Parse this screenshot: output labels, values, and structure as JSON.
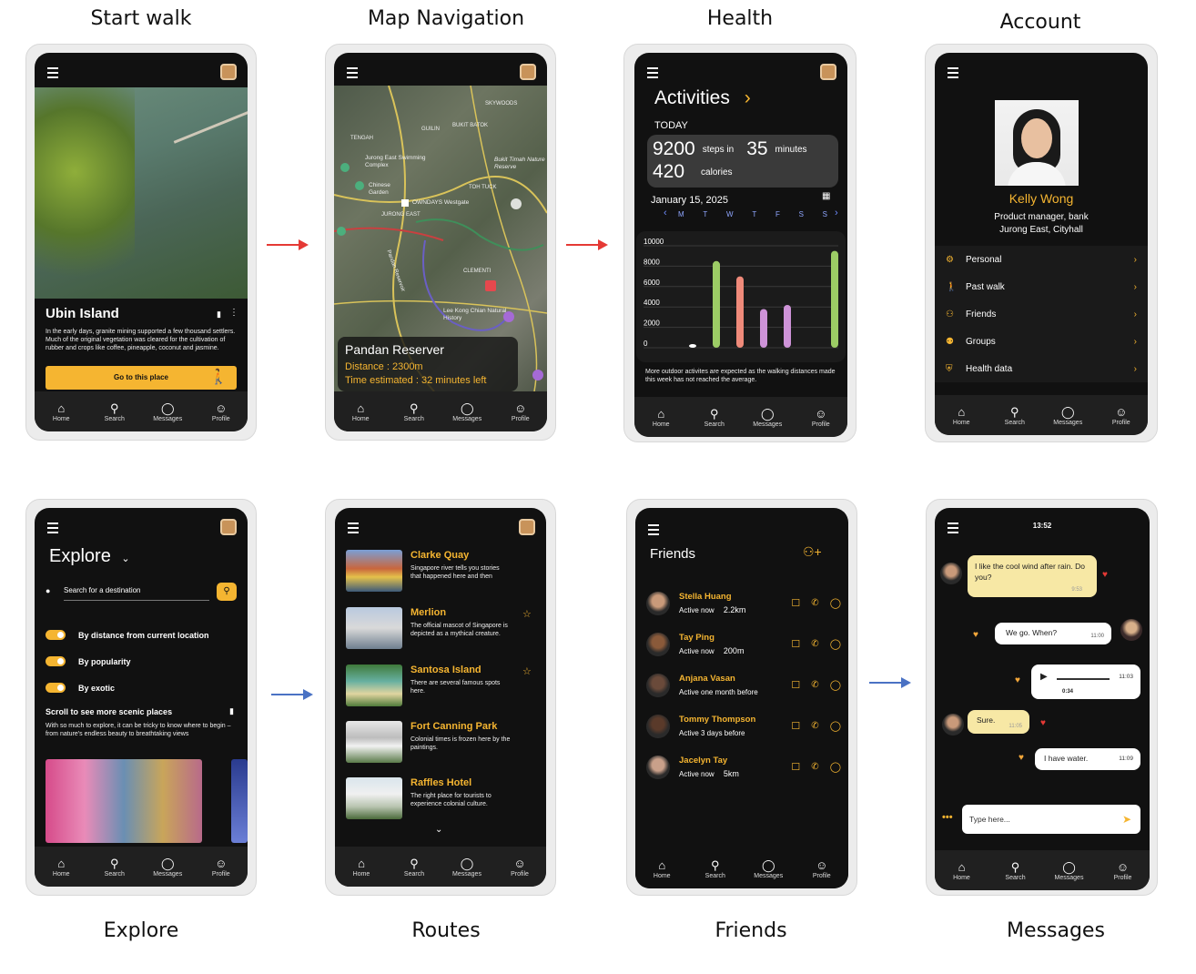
{
  "captions": {
    "start_walk": "Start walk",
    "map_navigation": "Map Navigation",
    "health": "Health",
    "account": "Account",
    "explore": "Explore",
    "routes": "Routes",
    "friends": "Friends",
    "messages": "Messages"
  },
  "nav": {
    "home": "Home",
    "search": "Search",
    "messages": "Messages",
    "profile": "Profile"
  },
  "start_walk": {
    "title": "Ubin Island",
    "description": "In the early days, granite mining supported a few thousand settlers. Much of the original vegetation was cleared for the cultivation of rubber and crops like coffee, pineapple, coconut and jasmine.",
    "button": "Go to this place"
  },
  "map": {
    "title": "Pandan Reserver",
    "distance": "Distance : 2300m",
    "time": "Time estimated : 32 minutes left",
    "labels": [
      "SKYWOODS",
      "BUKIT BATOK",
      "GUILIN",
      "TENGAH",
      "Jurong East Swimming Complex",
      "Bukit Timah Nature Reserve",
      "Chinese Garden",
      "TOH TUCK",
      "OWNDAYS Westgate",
      "JURONG EAST",
      "CLEMENTI",
      "Pandan Reservoir",
      "Lee Kong Chian Natural History"
    ]
  },
  "health": {
    "heading": "Activities",
    "today": "TODAY",
    "steps": "9200",
    "steps_label": "steps in",
    "minutes": "35",
    "minutes_label": "minutes",
    "calories": "420",
    "calories_label": "calories",
    "date": "January 15, 2025",
    "days": [
      "M",
      "T",
      "W",
      "T",
      "F",
      "S",
      "S"
    ],
    "note": "More outdoor activites are expected as the walking distances made this week has not reached the average."
  },
  "chart_data": {
    "type": "bar",
    "categories": [
      "M",
      "T",
      "W",
      "T",
      "F",
      "S",
      "S"
    ],
    "values": [
      200,
      8500,
      7000,
      3800,
      4200,
      0,
      9500
    ],
    "yticks": [
      "10000",
      "8000",
      "6000",
      "4000",
      "2000",
      "0"
    ],
    "ylim": [
      0,
      10000
    ],
    "colors": [
      "#ffffff",
      "#9ccc65",
      "#ef8a7a",
      "#ce93d8",
      "#ce93d8",
      "#ce93d8",
      "#9ccc65"
    ]
  },
  "account": {
    "name": "Kelly Wong",
    "role": "Product manager, bank",
    "location": "Jurong East, Cityhall",
    "menu": [
      {
        "icon": "gear-icon",
        "label": "Personal"
      },
      {
        "icon": "walk-icon",
        "label": "Past walk"
      },
      {
        "icon": "add-friend-icon",
        "label": "Friends"
      },
      {
        "icon": "group-icon",
        "label": "Groups"
      },
      {
        "icon": "shield-icon",
        "label": "Health data"
      }
    ]
  },
  "explore": {
    "heading": "Explore",
    "search_placeholder": "Search for a destination",
    "filters": [
      "By distance from current location",
      "By popularity",
      "By exotic"
    ],
    "scroll_title": "Scroll to see more scenic places",
    "scroll_text": "With so much to explore, it can be tricky to know where to begin – from nature's endless beauty to breathtaking views"
  },
  "routes": {
    "items": [
      {
        "name": "Clarke Quay",
        "desc": "Singapore river tells you stories that happened here and then"
      },
      {
        "name": "Merlion",
        "desc": "The official mascot of Singapore is depicted as a mythical creature."
      },
      {
        "name": "Santosa Island",
        "desc": "There are several famous spots here."
      },
      {
        "name": "Fort Canning Park",
        "desc": "Colonial times is frozen here by the paintings."
      },
      {
        "name": "Raffles Hotel",
        "desc": "The right place for tourists to experience colonial culture."
      }
    ]
  },
  "friends": {
    "heading": "Friends",
    "list": [
      {
        "name": "Stella Huang",
        "status": "Active now",
        "dist": "2.2km"
      },
      {
        "name": "Tay Ping",
        "status": "Active now",
        "dist": "200m"
      },
      {
        "name": "Anjana Vasan",
        "status": "Active one month before",
        "dist": ""
      },
      {
        "name": "Tommy Thompson",
        "status": "Active 3 days before",
        "dist": ""
      },
      {
        "name": "Jacelyn Tay",
        "status": "Active now",
        "dist": "5km"
      }
    ]
  },
  "messages": {
    "clock": "13:52",
    "m1": "I like the cool wind after rain. Do you?",
    "t1": "9:53",
    "m2": "We go. When?",
    "t2": "11:00",
    "audio_time": "11:03",
    "audio_len": "0:34",
    "m3": "Sure.",
    "t3": "11:05",
    "m4": "I have water.",
    "t4": "11:09",
    "input_placeholder": "Type here..."
  }
}
